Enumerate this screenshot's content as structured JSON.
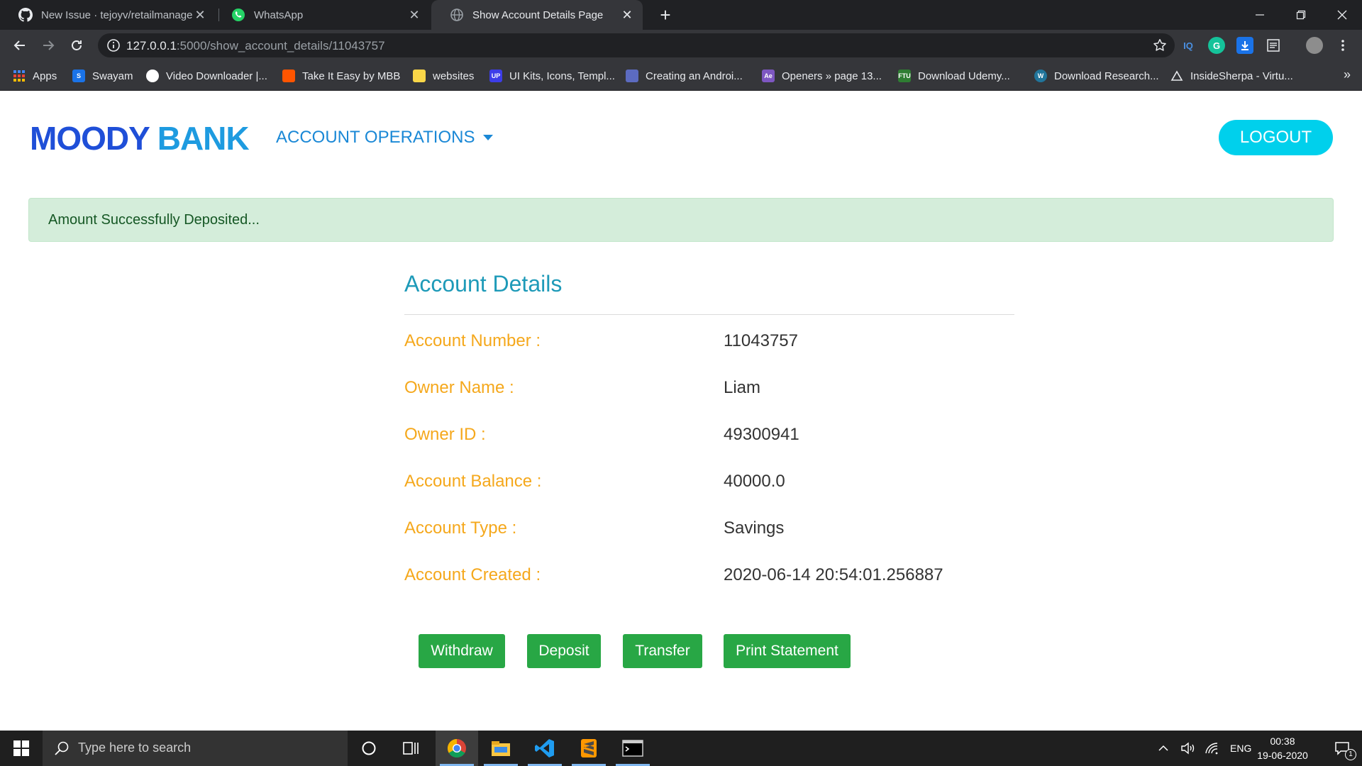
{
  "browser": {
    "tabs": [
      {
        "title": "New Issue · tejoyv/retailmanagem",
        "icon": "github-icon",
        "active": false
      },
      {
        "title": "WhatsApp",
        "icon": "whatsapp-icon",
        "active": false
      },
      {
        "title": "Show Account Details Page",
        "icon": "globe-icon",
        "active": true
      }
    ],
    "close_glyph": "✕",
    "new_tab_glyph": "+",
    "url_host": "127.0.0.1",
    "url_path": ":5000/show_account_details/11043757",
    "bookmarks": [
      {
        "label": "Apps",
        "icon": "apps-grid-icon",
        "color": "#4285f4"
      },
      {
        "label": "Swayam",
        "icon": "swayam-icon",
        "color": "#1a73e8"
      },
      {
        "label": "Video Downloader |...",
        "icon": "video-downloader-icon",
        "color": "#ffffff"
      },
      {
        "label": "Take It Easy by MBB",
        "icon": "soundcloud-icon",
        "color": "#ff5500"
      },
      {
        "label": "websites",
        "icon": "folder-icon",
        "color": "#f9d648"
      },
      {
        "label": "UI Kits, Icons, Templ...",
        "icon": "uplabs-icon",
        "color": "#3d3de8"
      },
      {
        "label": "Creating an Androi...",
        "icon": "android-dev-icon",
        "color": "#5c6bc0"
      },
      {
        "label": "Openers » page 13...",
        "icon": "openers-icon",
        "color": "#7e57c2"
      },
      {
        "label": "Download Udemy...",
        "icon": "ftu-icon",
        "color": "#2e7d32"
      },
      {
        "label": "Download Research...",
        "icon": "wordpress-icon",
        "color": "#21759b"
      },
      {
        "label": "InsideSherpa - Virtu...",
        "icon": "insidesherpa-icon",
        "color": "#e8eaed"
      }
    ],
    "bookmarks_more": "»",
    "extension_iq": "IQ",
    "extension_g": "G"
  },
  "header": {
    "brand_part1": "MOODY",
    "brand_part2": "BANK",
    "menu_label": "ACCOUNT OPERATIONS",
    "logout_label": "LOGOUT"
  },
  "alert": {
    "message": "Amount Successfully Deposited..."
  },
  "details": {
    "title": "Account Details",
    "rows": [
      {
        "label": "Account Number :",
        "value": "11043757"
      },
      {
        "label": "Owner Name :",
        "value": "Liam"
      },
      {
        "label": "Owner ID :",
        "value": "49300941"
      },
      {
        "label": "Account Balance :",
        "value": "40000.0"
      },
      {
        "label": "Account Type :",
        "value": "Savings"
      },
      {
        "label": "Account Created :",
        "value": "2020-06-14 20:54:01.256887"
      }
    ]
  },
  "actions": {
    "withdraw": "Withdraw",
    "deposit": "Deposit",
    "transfer": "Transfer",
    "print_statement": "Print Statement"
  },
  "taskbar": {
    "search_placeholder": "Type here to search",
    "language": "ENG",
    "time": "00:38",
    "date": "19-06-2020",
    "notification_count": "1"
  },
  "colors": {
    "brand_dark": "#1f4fd8",
    "brand_light": "#1e9be0",
    "label_orange": "#f5a81c",
    "success_green": "#28a745",
    "logout_cyan": "#00d0ec",
    "alert_bg": "#d4edda"
  }
}
